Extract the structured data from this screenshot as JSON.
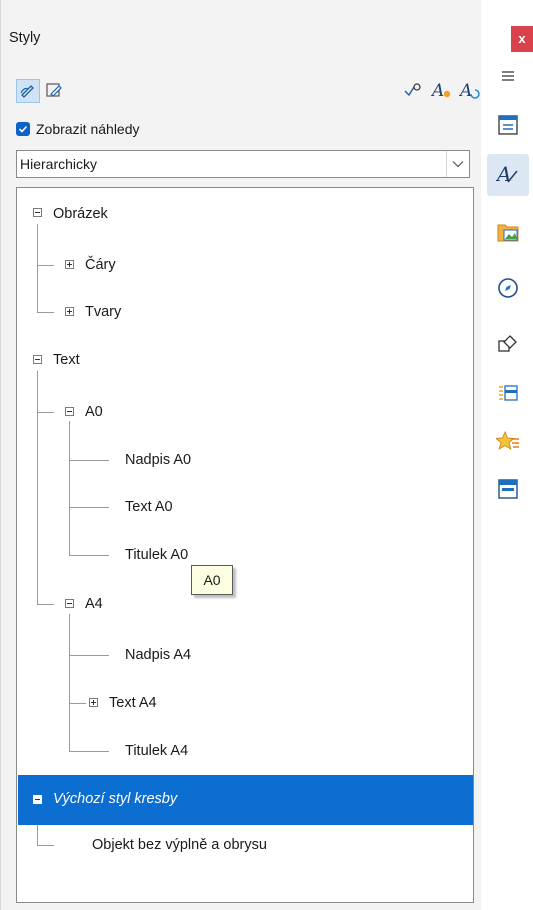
{
  "window": {
    "title": "Styly",
    "close_label": "x"
  },
  "toolbar": {
    "left_buttons": [
      {
        "icon": "paragraph-styles-icon",
        "active": true
      },
      {
        "icon": "frame-styles-icon",
        "active": false
      }
    ],
    "right_buttons": [
      {
        "icon": "fill-format-mode-icon"
      },
      {
        "icon": "new-style-from-selection-icon"
      },
      {
        "icon": "update-style-icon"
      }
    ]
  },
  "preview": {
    "checked": true,
    "label": "Zobrazit náhledy"
  },
  "filter": {
    "selected": "Hierarchicky"
  },
  "tree": {
    "items": [
      {
        "label": "Obrázek"
      },
      {
        "label": "Čáry"
      },
      {
        "label": "Tvary"
      },
      {
        "label": "Text"
      },
      {
        "label": "A0"
      },
      {
        "label": "Nadpis A0"
      },
      {
        "label": "Text A0"
      },
      {
        "label": "Titulek A0"
      },
      {
        "label": "A4"
      },
      {
        "label": "Nadpis A4"
      },
      {
        "label": "Text A4"
      },
      {
        "label": "Titulek A4"
      },
      {
        "label": "Výchozí styl kresby"
      },
      {
        "label": "Objekt bez výplně a obrysu"
      }
    ],
    "tooltip": "A0"
  },
  "sidebar": {
    "menu_icon": "hamburger-menu-icon",
    "items": [
      {
        "icon": "properties-icon",
        "active": false
      },
      {
        "icon": "styles-icon",
        "active": true
      },
      {
        "icon": "gallery-icon",
        "active": false
      },
      {
        "icon": "navigator-icon",
        "active": false
      },
      {
        "icon": "shapes-icon",
        "active": false
      },
      {
        "icon": "slide-transition-icon",
        "active": false
      },
      {
        "icon": "animation-icon",
        "active": false
      },
      {
        "icon": "master-slides-icon",
        "active": false
      }
    ]
  },
  "colors": {
    "accent": "#0b6ed0",
    "close": "#d9414c",
    "panel": "#f3f3f3"
  }
}
